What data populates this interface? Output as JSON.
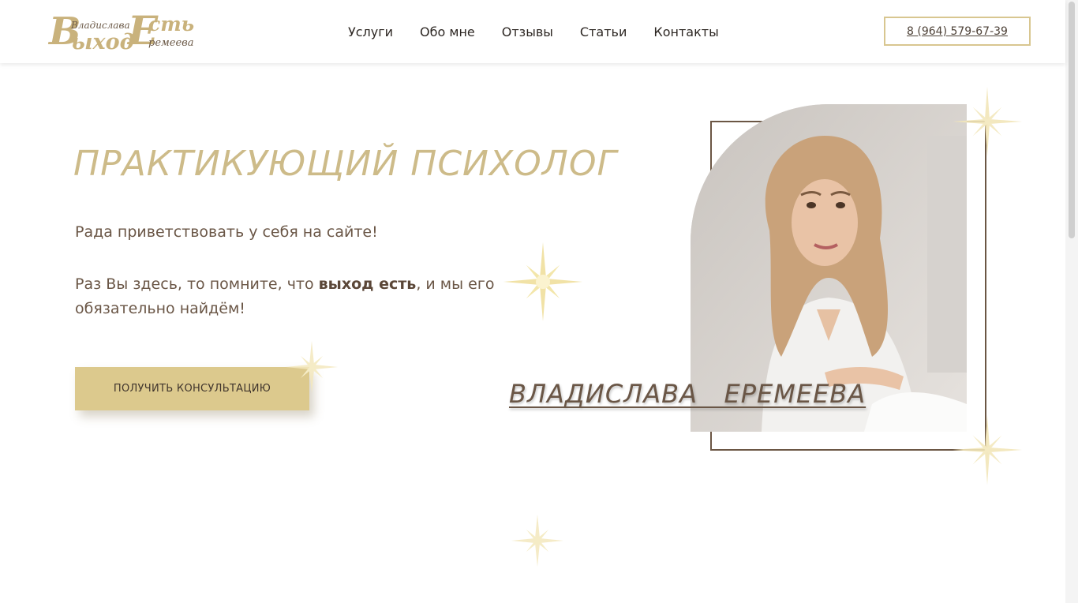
{
  "logo": {
    "big1": "В",
    "big1_rest": "ыход",
    "big2": "Е",
    "big2_rest": "сть",
    "small1": "Владислава",
    "small2": "ремеева"
  },
  "nav": {
    "items": [
      "Услуги",
      "Обо мне",
      "Отзывы",
      "Статьи",
      "Контакты"
    ]
  },
  "phone": "8 (964) 579-67-39",
  "hero": {
    "title": "ПРАКТИКУЮЩИЙ ПСИХОЛОГ",
    "greeting": "Рада приветствовать у себя на сайте!",
    "msg_before": "Раз Вы здесь, то помните, что ",
    "msg_bold": "выход есть",
    "msg_after": ", и мы его обязательно найдём!",
    "cta": "ПОЛУЧИТЬ КОНСУЛЬТАЦИЮ",
    "name": "ВЛАДИСЛАВА   ЕРЕМЕЕВА"
  },
  "colors": {
    "gold": "#cdbb89",
    "button": "#dcc98d",
    "brown": "#6a5646"
  }
}
